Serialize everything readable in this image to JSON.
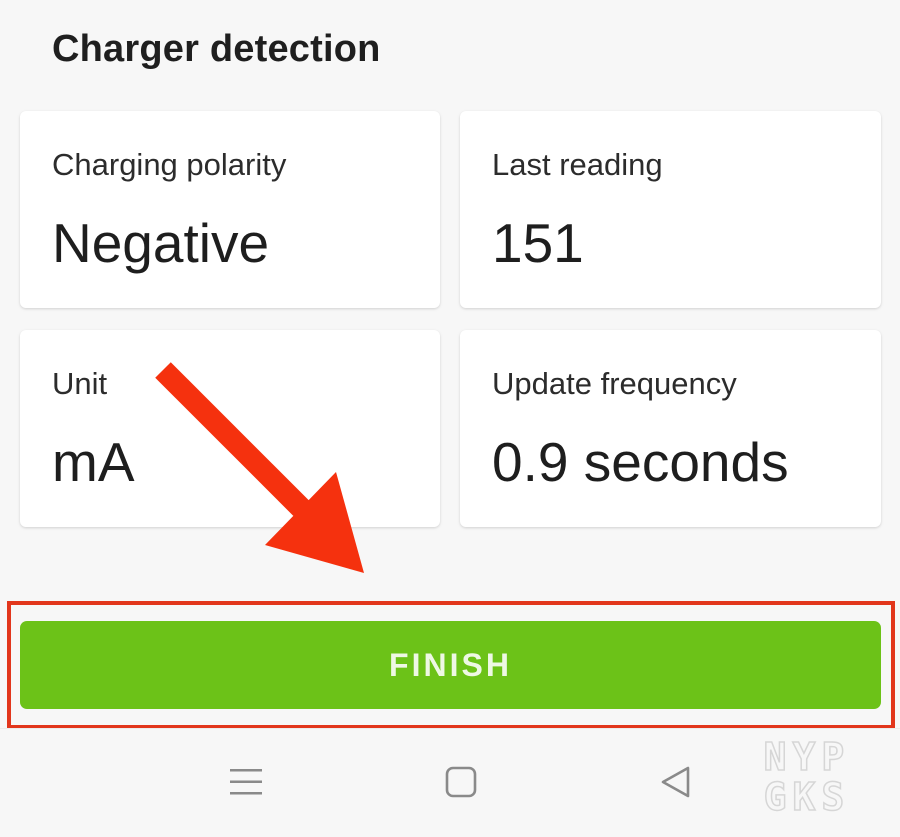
{
  "header": {
    "title": "Charger detection"
  },
  "cards": {
    "polarity": {
      "label": "Charging polarity",
      "value": "Negative"
    },
    "reading": {
      "label": "Last reading",
      "value": "151"
    },
    "unit": {
      "label": "Unit",
      "value": "mA"
    },
    "frequency": {
      "label": "Update frequency",
      "value": "0.9 seconds"
    }
  },
  "action": {
    "finish_label": "FINISH"
  },
  "navbar": {
    "icons": [
      "menu-icon",
      "home-icon",
      "back-icon"
    ]
  },
  "watermark": {
    "line1": "NYP",
    "line2": "GKS"
  },
  "colors": {
    "background": "#f7f7f7",
    "card": "#ffffff",
    "accent_green": "#6cc218",
    "annotation_red": "#e2361c"
  }
}
